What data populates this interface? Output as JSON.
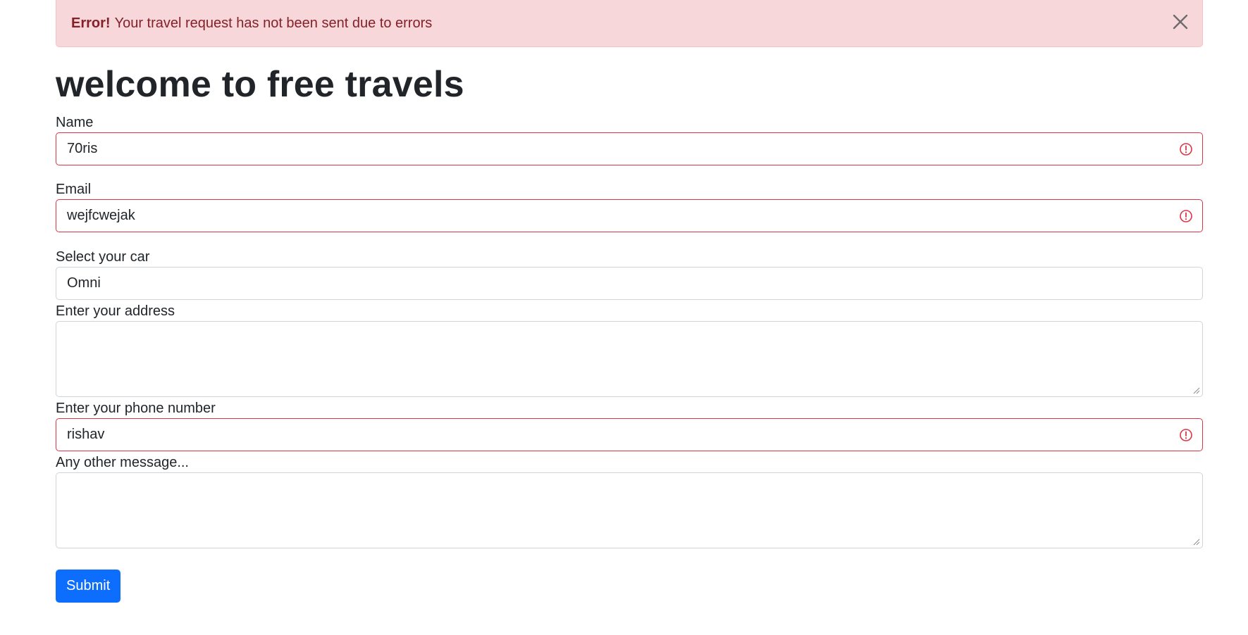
{
  "alert": {
    "strong": "Error!",
    "message": "Your travel request has not been sent due to errors"
  },
  "page_title": "welcome to free travels",
  "form": {
    "name": {
      "label": "Name",
      "value": "70ris"
    },
    "email": {
      "label": "Email",
      "value": "wejfcwejak"
    },
    "car": {
      "label": "Select your car",
      "value": "Omni"
    },
    "address": {
      "label": "Enter your address",
      "value": ""
    },
    "phone": {
      "label": "Enter your phone number",
      "value": "rishav"
    },
    "message": {
      "label": "Any other message...",
      "value": ""
    },
    "submit_label": "Submit"
  },
  "colors": {
    "error": "#dc3545",
    "alert_bg": "#f8d7da",
    "primary": "#0d6efd"
  },
  "icons": {
    "alert_close": "close-icon",
    "field_invalid": "exclamation-circle-icon"
  }
}
